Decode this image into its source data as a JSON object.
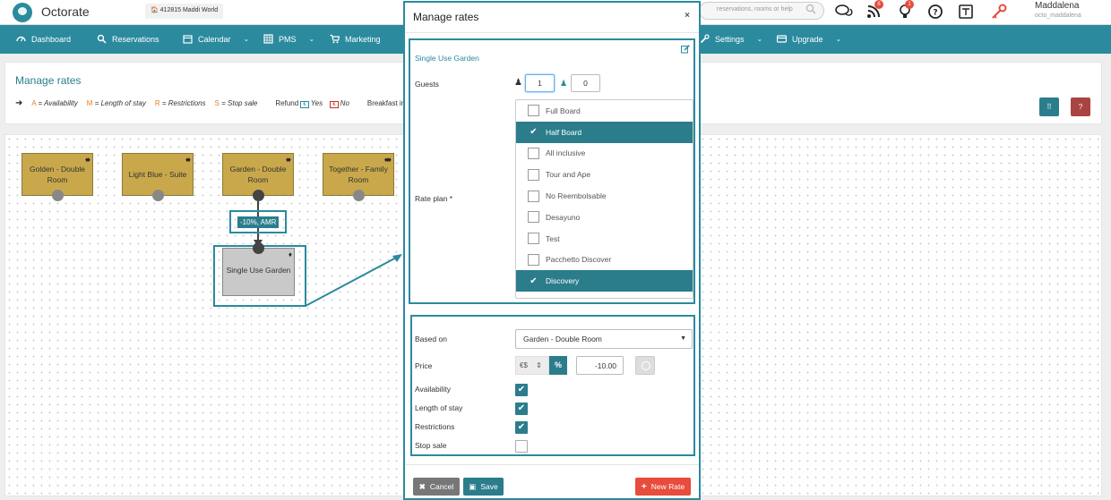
{
  "topbar": {
    "brand": "Octorate",
    "hotel_chip": "🏠 412815   Maddi World",
    "search_placeholder": "reservations, rooms or help",
    "notifications": {
      "feed_badge": "8",
      "bulb_badge": "1"
    },
    "user_name": "Maddalena",
    "user_sub": "octo_maddalena"
  },
  "nav": {
    "items": [
      {
        "label": "Dashboard",
        "icon": "dashboard-icon"
      },
      {
        "label": "Reservations",
        "icon": "reservations-icon"
      },
      {
        "label": "Calendar",
        "icon": "calendar-icon"
      },
      {
        "label": "PMS",
        "icon": "pms-icon"
      },
      {
        "label": "Marketing",
        "icon": "cart-icon"
      },
      {
        "label": "Settings",
        "icon": "wrench-icon"
      },
      {
        "label": "Upgrade",
        "icon": "card-icon"
      }
    ]
  },
  "panel": {
    "title": "Manage rates",
    "legend": {
      "a_key": "A",
      "a_text": "= Availability",
      "m_key": "M",
      "m_text": "= Length of stay",
      "r_key": "R",
      "r_text": "= Restrictions",
      "s_key": "S",
      "s_text": "= Stop sale",
      "refund_label": "Refund",
      "yes": "Yes",
      "no": "No",
      "breakfast": "Breakfast inc"
    }
  },
  "canvas": {
    "nodes": [
      {
        "label": "Golden - Double Room"
      },
      {
        "label": "Light Blue - Suite"
      },
      {
        "label": "Garden - Double Room"
      },
      {
        "label": "Together - Family Room"
      },
      {
        "label": "Single Use Garden"
      }
    ],
    "edge_label": "-10%, AMR"
  },
  "modal": {
    "title": "Manage rates",
    "close": "×",
    "room_name": "Single Use Garden",
    "guests_label": "Guests",
    "adults_value": "1",
    "children_value": "0",
    "rate_plan_label": "Rate plan *",
    "rate_plans": [
      {
        "label": "Full Board",
        "selected": false
      },
      {
        "label": "Half Board",
        "selected": true
      },
      {
        "label": "All inclusive",
        "selected": false
      },
      {
        "label": "Tour and Ape",
        "selected": false
      },
      {
        "label": "No Reembolsable",
        "selected": false
      },
      {
        "label": "Desayuno",
        "selected": false
      },
      {
        "label": "Test",
        "selected": false
      },
      {
        "label": "Pacchetto Discover",
        "selected": false
      },
      {
        "label": "Discovery",
        "selected": true
      }
    ],
    "based_on_label": "Based on",
    "based_on_value": "Garden - Double Room",
    "price_label": "Price",
    "price_mode": "%",
    "price_value": "-10.00",
    "availability_label": "Availability",
    "los_label": "Length of stay",
    "restrictions_label": "Restrictions",
    "stop_sale_label": "Stop sale",
    "checks": {
      "availability": true,
      "los": true,
      "restrictions": true,
      "stop_sale": false
    },
    "cancel_label": "Cancel",
    "save_label": "Save",
    "new_rate_label": "New Rate"
  },
  "colors": {
    "accent": "#2b8a9e",
    "dark_accent": "#2b7d8c",
    "node_gold": "#c9a84c",
    "danger": "#e74c3c",
    "help_btn": "#a94442"
  }
}
